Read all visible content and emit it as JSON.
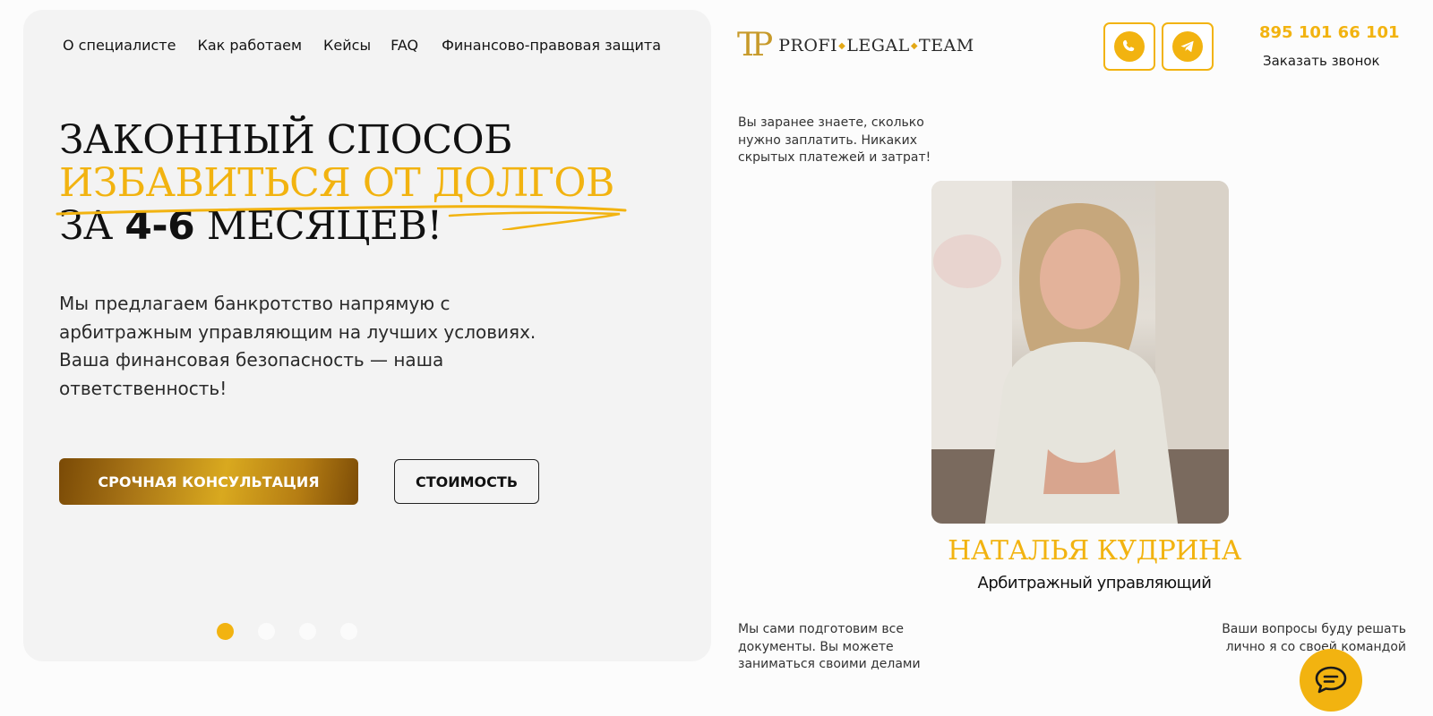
{
  "nav": {
    "items": [
      {
        "label": "О специалисте"
      },
      {
        "label": "Как работаем"
      },
      {
        "label": "Кейсы"
      },
      {
        "label": "FAQ"
      },
      {
        "label": "Финансово-правовая защита"
      }
    ]
  },
  "hero": {
    "title_line1": "ЗАКОННЫЙ СПОСОБ",
    "title_line2": "ИЗБАВИТЬСЯ ОТ ДОЛГОВ",
    "title_line3_prefix": "ЗА",
    "title_line3_number": "4-6",
    "title_line3_suffix": "МЕСЯЦЕВ!",
    "lead": "Мы предлагаем банкротство напрямую с арбитражным управляющим на лучших условиях. Ваша финансовая безопасность — наша ответственность!",
    "primary_button": "СРОЧНАЯ КОНСУЛЬТАЦИЯ",
    "secondary_button": "СТОИМОСТЬ",
    "slides_total": 4,
    "slide_active": 1
  },
  "logo": {
    "mark": "TP",
    "word1": "PROFI",
    "word2": "LEGAL",
    "word3": "TEAM"
  },
  "contacts": {
    "phone": "895 101 66 101",
    "callback": "Заказать звонок"
  },
  "notes": {
    "top_left": "Вы заранее знаете, сколько нужно заплатить. Никаких скрытых платежей и затрат!",
    "bottom_left": "Мы сами подготовим все документы. Вы можете заниматься своими делами",
    "bottom_right": "Ваши вопросы буду решать лично я со своей командой"
  },
  "specialist": {
    "name": "НАТАЛЬЯ КУДРИНА",
    "role": "Арбитражный управляющий"
  },
  "colors": {
    "accent": "#f2b310",
    "card_bg": "#f3f3f3",
    "text": "#111111"
  },
  "icons": {
    "whatsapp": "whatsapp-icon",
    "telegram": "telegram-icon",
    "chat": "chat-icon"
  }
}
